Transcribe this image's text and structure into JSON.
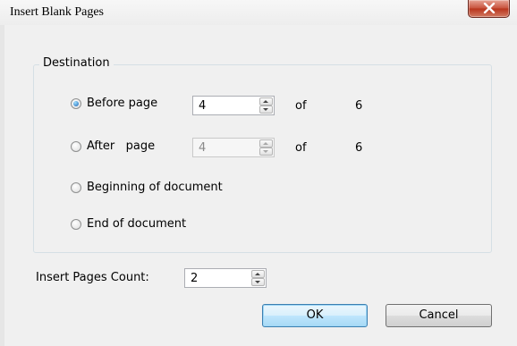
{
  "window": {
    "title": "Insert Blank Pages",
    "close_label": "X"
  },
  "destination": {
    "legend": "Destination",
    "before": {
      "label": "Before page",
      "value": "4",
      "of_label": "of",
      "total": "6",
      "selected": true
    },
    "after": {
      "label": "After   page",
      "value": "4",
      "of_label": "of",
      "total": "6",
      "selected": false
    },
    "beginning": {
      "label": "Beginning of document",
      "selected": false
    },
    "end": {
      "label": "End of document",
      "selected": false
    }
  },
  "count": {
    "label": "Insert Pages Count:",
    "value": "2"
  },
  "buttons": {
    "ok": "OK",
    "cancel": "Cancel"
  },
  "colors": {
    "accent": "#3c7fb1",
    "close_button": "#c7513b",
    "background": "#f0f0f0"
  }
}
